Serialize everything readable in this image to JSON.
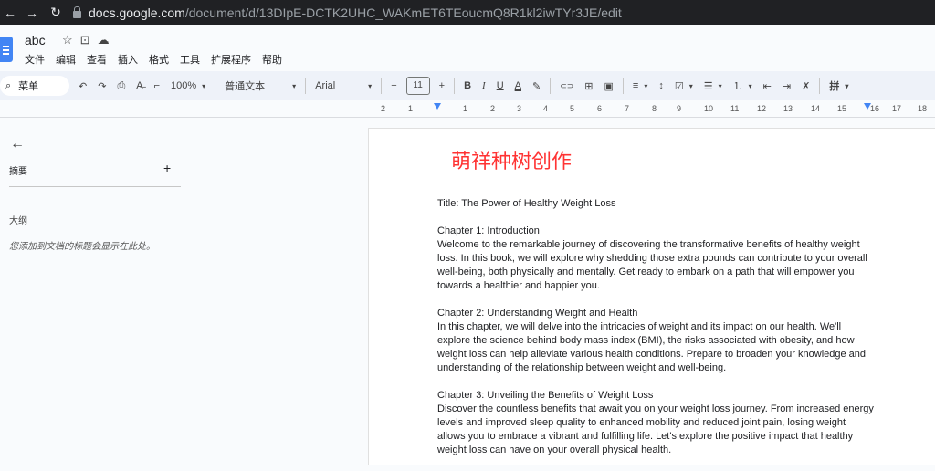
{
  "browser": {
    "url_host": "docs.google.com",
    "url_path": "/document/d/13DIpE-DCTK2UHC_WAKmET6TEoucmQ8R1kl2iwTYr3JE/edit",
    "back_glyph": "←",
    "forward_glyph": "→",
    "reload_glyph": "↻"
  },
  "doc": {
    "title": "abc",
    "icons": {
      "star": "☆",
      "folder": "⊡",
      "cloud": "☁"
    }
  },
  "menu": [
    "文件",
    "编辑",
    "查看",
    "插入",
    "格式",
    "工具",
    "扩展程序",
    "帮助"
  ],
  "toolbar": {
    "search_label": "菜单",
    "search_icon": "⌕",
    "undo": "↶",
    "redo": "↷",
    "print": "⎙",
    "spell": "A̶",
    "paint": "⌐",
    "zoom": "100%",
    "style": "普通文本",
    "font": "Arial",
    "minus": "−",
    "font_size": "11",
    "plus": "+",
    "bold": "B",
    "italic": "I",
    "underline": "U",
    "text_color": "A",
    "highlight": "✎",
    "link": "⊂⊃",
    "comment": "⊞",
    "image": "▣",
    "align": "≡",
    "line_spacing": "↕",
    "checklist": "☑",
    "bullets": "☰",
    "numbered": "⒈",
    "outdent": "⇤",
    "indent": "⇥",
    "clear": "✗",
    "input_tool": "拼",
    "caret": "▾"
  },
  "ruler": {
    "ticks": [
      "2",
      "1",
      "1",
      "2",
      "3",
      "4",
      "5",
      "6",
      "7",
      "8",
      "9",
      "10",
      "11",
      "12",
      "13",
      "14",
      "15",
      "16",
      "17",
      "18"
    ]
  },
  "sidebar": {
    "back_glyph": "←",
    "summary_label": "摘要",
    "add_glyph": "+",
    "outline_label": "大纲",
    "outline_hint": "您添加到文档的标题会显示在此处。"
  },
  "content": {
    "heading": "萌祥种树创作",
    "heading_color": "#ff3333",
    "paragraphs": [
      "Title: The Power of Healthy Weight Loss",
      "Chapter 1: Introduction",
      "Welcome to the remarkable journey of discovering the transformative benefits of healthy weight loss. In this book, we will explore why shedding those extra pounds can contribute to your overall well-being, both physically and mentally. Get ready to embark on a path that will empower you towards a healthier and happier you.",
      "Chapter 2: Understanding Weight and Health",
      "In this chapter, we will delve into the intricacies of weight and its impact on our health. We'll explore the science behind body mass index (BMI), the risks associated with obesity, and how weight loss can help alleviate various health conditions. Prepare to broaden your knowledge and understanding of the relationship between weight and well-being.",
      "Chapter 3: Unveiling the Benefits of Weight Loss",
      "Discover the countless benefits that await you on your weight loss journey. From increased energy levels and improved sleep quality to enhanced mobility and reduced joint pain, losing weight allows you to embrace a vibrant and fulfilling life. Let's explore the positive impact that healthy weight loss can have on your overall physical health."
    ]
  }
}
